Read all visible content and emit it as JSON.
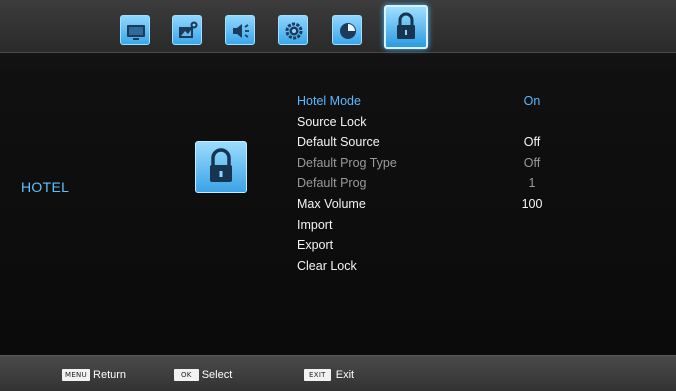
{
  "tabs": [
    {
      "name": "picture",
      "icon": "tv-icon",
      "active": false
    },
    {
      "name": "image-settings",
      "icon": "image-settings-icon",
      "active": false
    },
    {
      "name": "sound",
      "icon": "speaker-icon",
      "active": false
    },
    {
      "name": "setup",
      "icon": "gear-icon",
      "active": false
    },
    {
      "name": "time",
      "icon": "clock-icon",
      "active": false
    },
    {
      "name": "lock",
      "icon": "lock-icon",
      "active": true
    }
  ],
  "section": {
    "label": "HOTEL",
    "icon": "lock-icon"
  },
  "menu": [
    {
      "label": "Hotel Mode",
      "value": "On",
      "state": "selected"
    },
    {
      "label": "Source Lock",
      "value": "",
      "state": "normal"
    },
    {
      "label": "Default Source",
      "value": "Off",
      "state": "normal"
    },
    {
      "label": "Default Prog Type",
      "value": "Off",
      "state": "dim"
    },
    {
      "label": "Default Prog",
      "value": "1",
      "state": "dim"
    },
    {
      "label": "Max Volume",
      "value": "100",
      "state": "normal"
    },
    {
      "label": "Import",
      "value": "",
      "state": "normal"
    },
    {
      "label": "Export",
      "value": "",
      "state": "normal"
    },
    {
      "label": "Clear Lock",
      "value": "",
      "state": "normal"
    }
  ],
  "hints": [
    {
      "key": "MENU",
      "label": "Return"
    },
    {
      "key": "OK",
      "label": "Select"
    },
    {
      "key": "EXIT",
      "label": "Exit"
    }
  ],
  "colors": {
    "accent": "#5ab8ff",
    "tab_blue": "#3aa7ea",
    "dim_text": "#9a9a9a"
  }
}
